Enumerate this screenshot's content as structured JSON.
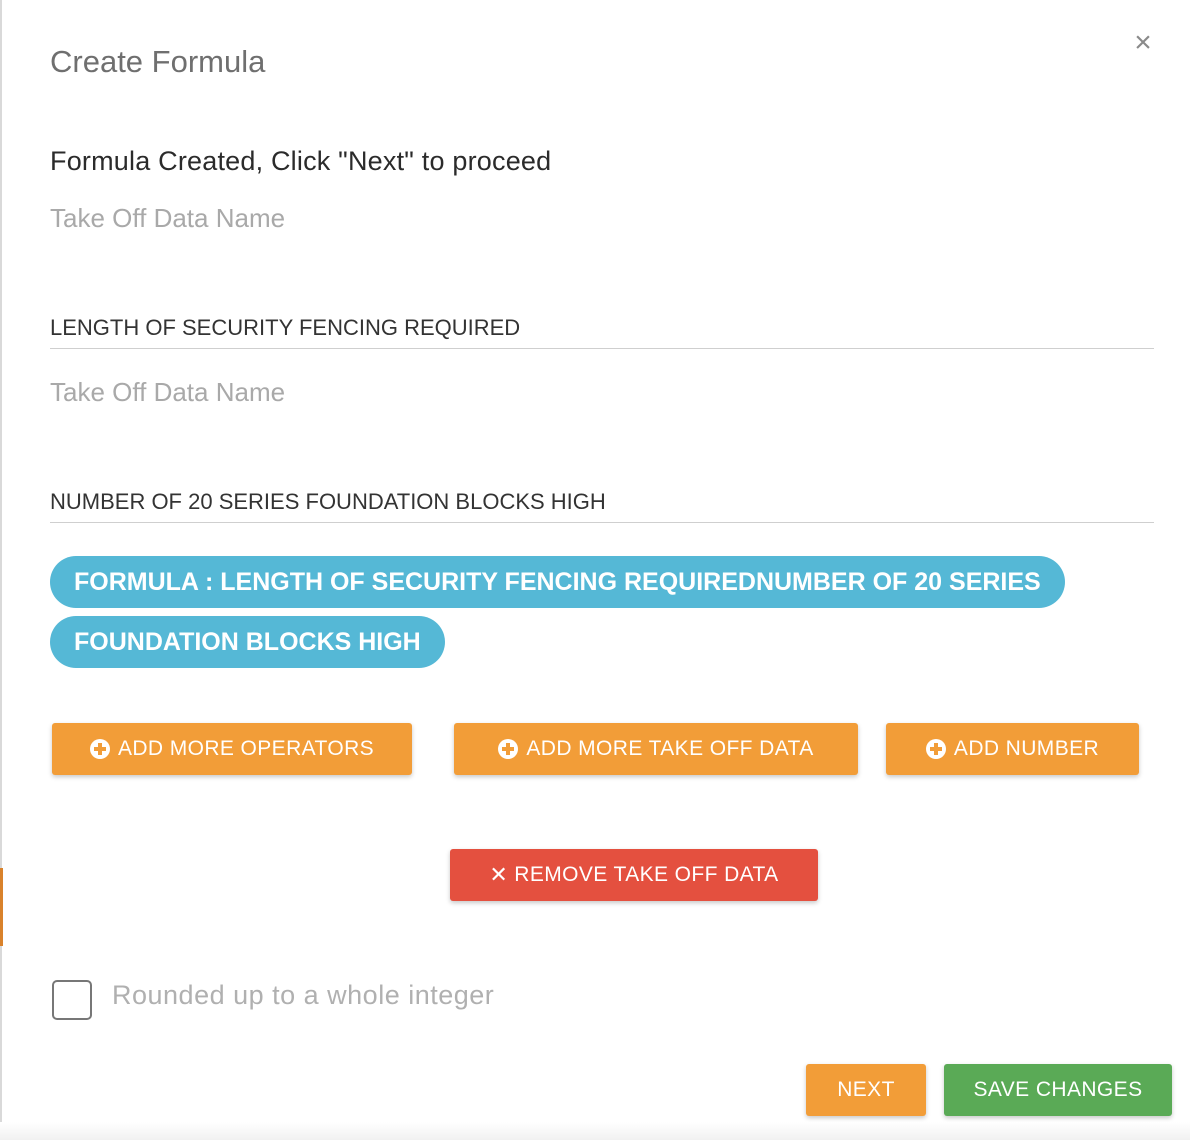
{
  "modal": {
    "title": "Create Formula",
    "close_glyph": "×",
    "status_message": "Formula Created, Click \"Next\" to proceed"
  },
  "fields": [
    {
      "label": "Take Off Data Name",
      "value": "LENGTH OF SECURITY FENCING REQUIRED"
    },
    {
      "label": "Take Off Data Name",
      "value": "NUMBER OF 20 SERIES FOUNDATION BLOCKS HIGH"
    }
  ],
  "formula": {
    "text": "FORMULA : LENGTH OF SECURITY FENCING REQUIREDNUMBER OF 20 SERIES FOUNDATION BLOCKS HIGH"
  },
  "actions": {
    "add_operators": "ADD MORE OPERATORS",
    "add_take_off_data": "ADD MORE TAKE OFF DATA",
    "add_number": "ADD NUMBER",
    "remove_take_off_data": "REMOVE TAKE OFF DATA"
  },
  "rounding": {
    "label": "Rounded up to a whole integer",
    "checked": false
  },
  "footer": {
    "next": "NEXT",
    "save": "SAVE CHANGES"
  },
  "colors": {
    "orange": "#f29d38",
    "red": "#e4503f",
    "green": "#5aaa56",
    "formula_bg": "#55b8d6"
  },
  "icons": {
    "close": "close-icon",
    "plus": "plus-circle-icon",
    "remove": "x-icon"
  }
}
